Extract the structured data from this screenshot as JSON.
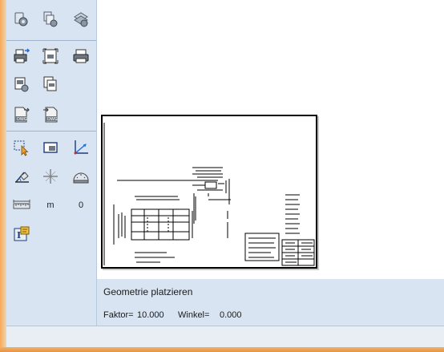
{
  "toolbar": {
    "icons": [
      {
        "name": "geometry-fixed-icon",
        "color": "#6b7b8c"
      },
      {
        "name": "geometry-copy-icon",
        "color": "#6b7b8c"
      },
      {
        "name": "geometry-settings-icon",
        "color": "#6b7b8c"
      },
      {
        "name": "print-export-icon",
        "color": "#3c4a5a"
      },
      {
        "name": "print-preview-icon",
        "color": "#3c4a5a"
      },
      {
        "name": "printer-icon",
        "color": "#3c4a5a"
      },
      {
        "name": "plot-config-icon",
        "color": "#3c4a5a"
      },
      {
        "name": "plot-sheets-icon",
        "color": "#3c4a5a"
      },
      {
        "name": "dwg-export-icon",
        "color": "#3c4a5a"
      },
      {
        "name": "dwg-import-icon",
        "color": "#3c4a5a"
      },
      {
        "name": "select-pointer-icon",
        "color": "#1e6ad8"
      },
      {
        "name": "frame-select-icon",
        "color": "#1e3a7a"
      },
      {
        "name": "coordinate-axes-icon",
        "color": "#1e3a7a"
      },
      {
        "name": "rotate-angle-icon",
        "color": "#3c4a5a"
      },
      {
        "name": "crosshair-icon",
        "color": "#3c4a5a"
      },
      {
        "name": "protractor-icon",
        "color": "#3c4a5a"
      },
      {
        "name": "scale-ruler-icon",
        "color": "#3c4a5a"
      },
      {
        "name": "info-text-icon",
        "color": "#1e3a7a"
      }
    ],
    "unit_label": "m",
    "zero_label": "0"
  },
  "status": {
    "prompt": "Geometrie platzieren",
    "faktor_label": "Faktor=",
    "faktor_value": "10.000",
    "winkel_label": "Winkel=",
    "winkel_value": "0.000"
  },
  "colors": {
    "panel": "#d8e4f2",
    "window_frame": "#f0a050",
    "accent_blue": "#1e6ad8"
  }
}
